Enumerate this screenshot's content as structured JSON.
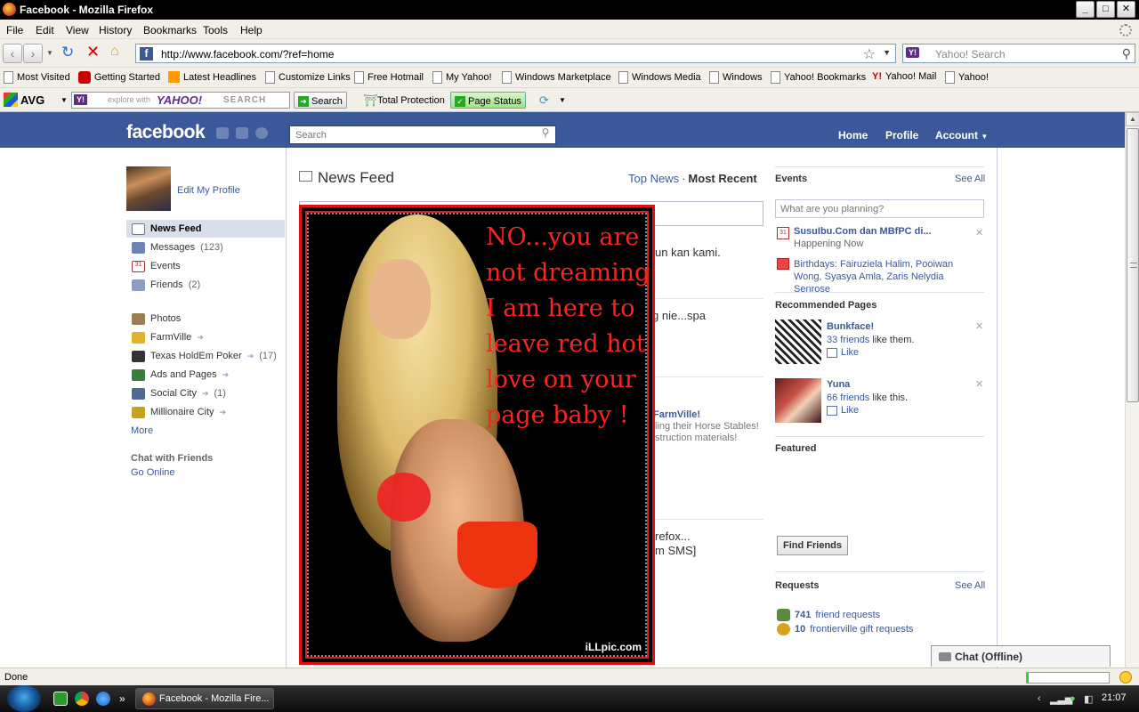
{
  "window": {
    "title": "Facebook - Mozilla Firefox",
    "buttons": {
      "minimize": "_",
      "maximize": "□",
      "close": "✕"
    }
  },
  "menu": [
    "File",
    "Edit",
    "View",
    "History",
    "Bookmarks",
    "Tools",
    "Help"
  ],
  "navigation": {
    "url": "http://www.facebook.com/?ref=home",
    "search_placeholder": "Yahoo! Search",
    "search_engine": "Y!"
  },
  "bookmarks": [
    "Most Visited",
    "Getting Started",
    "Latest Headlines",
    "Customize Links",
    "Free Hotmail",
    "My Yahoo!",
    "Windows Marketplace",
    "Windows Media",
    "Windows",
    "Yahoo! Bookmarks",
    "Yahoo! Mail",
    "Yahoo!"
  ],
  "toolbar": {
    "avg": "AVG",
    "yahoo_badge": "Y!",
    "explore_with": "explore with",
    "yahoo": "YAHOO!",
    "search_word": "SEARCH",
    "search_button": "Search",
    "total_protection": "Total Protection",
    "page_status": "Page Status"
  },
  "facebook": {
    "logo": "facebook",
    "search_placeholder": "Search",
    "nav": {
      "home": "Home",
      "profile": "Profile",
      "account": "Account"
    },
    "brand_color": "#3b5998",
    "left": {
      "edit_profile": "Edit My Profile",
      "items": [
        {
          "label": "News Feed",
          "count": "",
          "icon": "news-feed-icon"
        },
        {
          "label": "Messages",
          "count": "(123)",
          "icon": "messages-icon"
        },
        {
          "label": "Events",
          "count": "",
          "icon": "events-icon"
        },
        {
          "label": "Friends",
          "count": "(2)",
          "icon": "friends-icon"
        }
      ],
      "apps": [
        {
          "label": "Photos",
          "count": "",
          "icon": "photos-icon"
        },
        {
          "label": "FarmVille",
          "count": "",
          "icon": "farmville-icon"
        },
        {
          "label": "Texas HoldEm Poker",
          "count": "(17)",
          "icon": "poker-icon"
        },
        {
          "label": "Ads and Pages",
          "count": "",
          "icon": "ads-icon"
        },
        {
          "label": "Social City",
          "count": "(1)",
          "icon": "social-city-icon"
        },
        {
          "label": "Millionaire City",
          "count": "",
          "icon": "millionaire-city-icon"
        }
      ],
      "more": "More",
      "chat_title": "Chat with Friends",
      "go_online": "Go Online"
    },
    "feed": {
      "title": "News Feed",
      "tab_top": "Top News",
      "separator": "·",
      "tab_recent": "Most Recent",
      "fragments": [
        "un kan kami.",
        "g nie...spa",
        "FarmVille!",
        "ling their Horse Stables!",
        "struction materials!",
        "refox...",
        "m SMS]"
      ]
    },
    "overlay_image": {
      "slogan": "NO...you are not dreaming I am here to leave red hot love on your page baby !",
      "watermark": "iLLpic.com"
    },
    "right": {
      "events_title": "Events",
      "see_all": "See All",
      "plan_placeholder": "What are you planning?",
      "event_name": "SusuIbu.Com dan MBfPC di...",
      "event_status": "Happening Now",
      "birthdays": "Birthdays: Fairuziela Halim, Pooiwan Wong, Syasya Amla, Zaris Nelydia Senrose",
      "recommended_title": "Recommended Pages",
      "pages": [
        {
          "name": "Bunkface!",
          "friends": "33 friends",
          "suffix": "like them.",
          "like": "Like"
        },
        {
          "name": "Yuna",
          "friends": "66 friends",
          "suffix": "like this.",
          "like": "Like"
        }
      ],
      "featured_title": "Featured",
      "find_friends": "Find Friends",
      "requests_title": "Requests",
      "requests": [
        {
          "count": "741",
          "label": "friend requests"
        },
        {
          "count": "10",
          "label": "frontierville gift requests"
        }
      ],
      "chat": "Chat (Offline)"
    }
  },
  "status": {
    "text": "Done",
    "progress": 0.02
  },
  "taskbar": {
    "task": "Facebook - Mozilla Fire...",
    "chevron": "»",
    "clock": "21:07"
  }
}
